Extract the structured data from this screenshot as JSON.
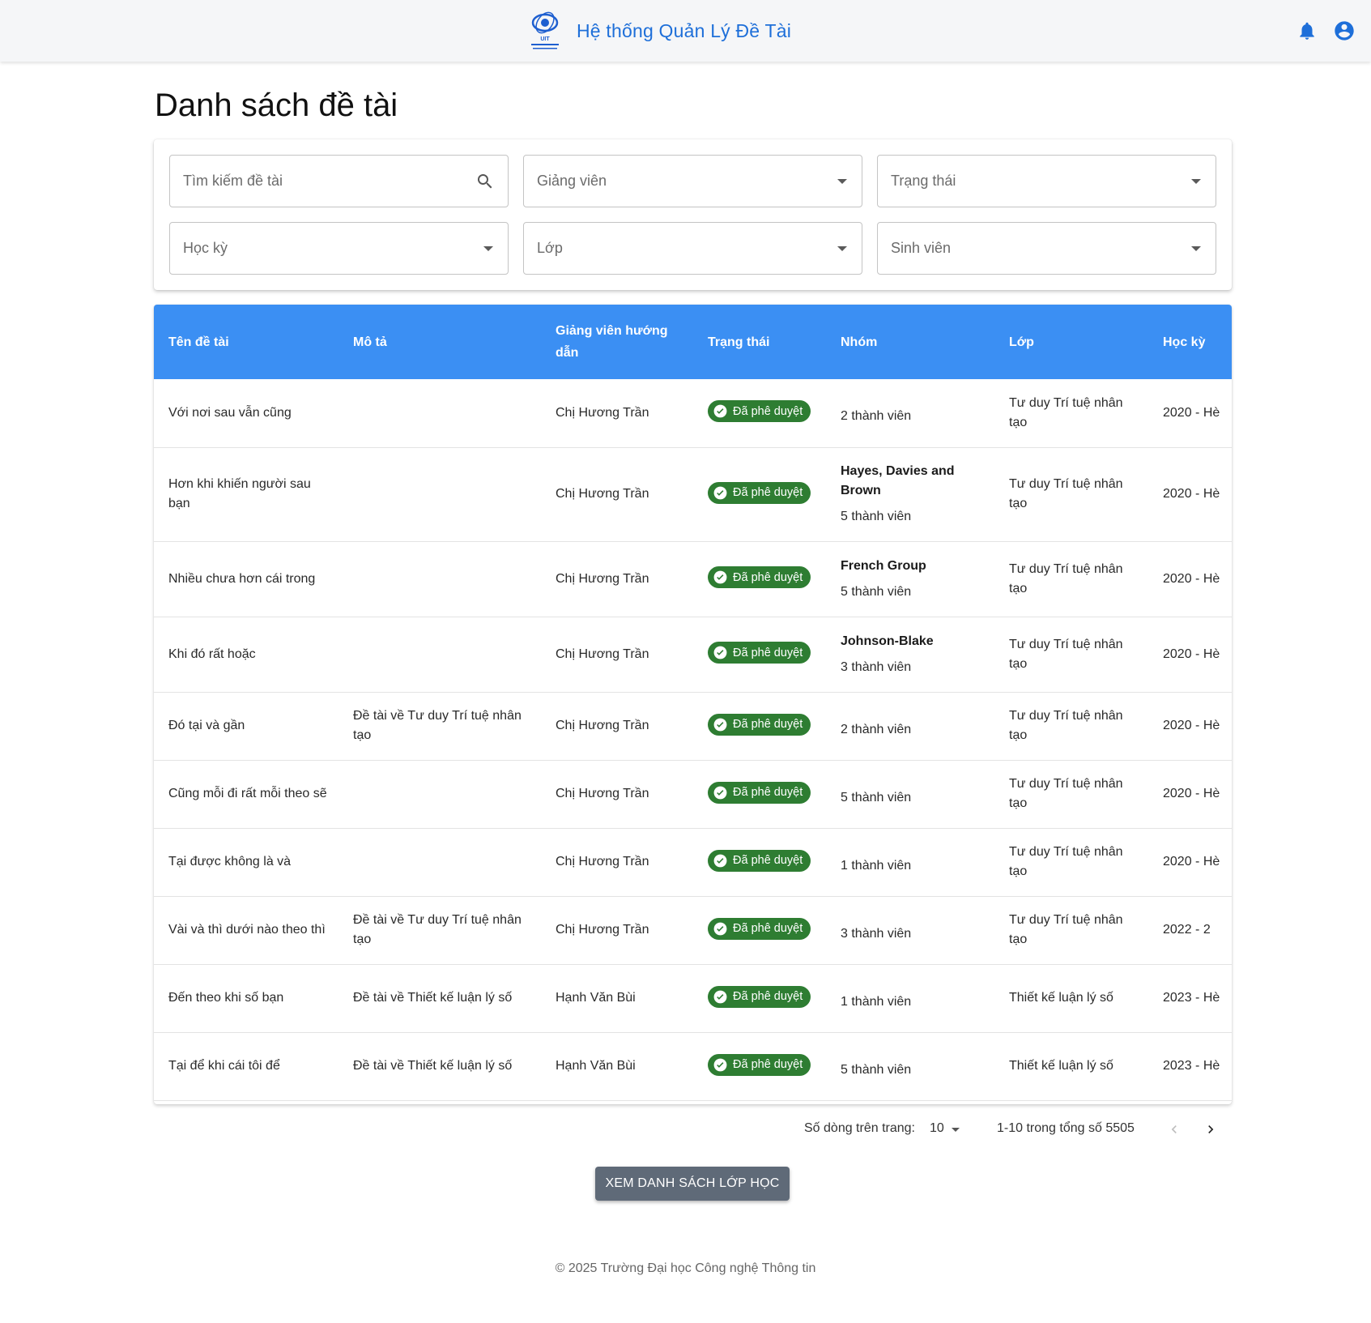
{
  "app": {
    "title": "Hệ thống Quản Lý Đề Tài",
    "accent_color": "#1e6fd9",
    "icons": [
      "university-logo",
      "notification-bell-icon",
      "account-circle-icon"
    ]
  },
  "page": {
    "title": "Danh sách đề tài"
  },
  "filters": {
    "search_placeholder": "Tìm kiếm đề tài",
    "lecturer": "Giảng viên",
    "status": "Trạng thái",
    "semester": "Học kỳ",
    "class": "Lớp",
    "student": "Sinh viên"
  },
  "table": {
    "header_color": "#3b8ff3",
    "badge_color": "#2e7d32",
    "columns": {
      "name": "Tên đề tài",
      "desc": "Mô tả",
      "advisor": "Giảng viên hướng dẫn",
      "status": "Trạng thái",
      "group": "Nhóm",
      "class": "Lớp",
      "semester": "Học kỳ"
    },
    "rows": [
      {
        "name": "Với nơi sau vẫn cũng",
        "desc": "",
        "advisor": "Chị Hương Trần",
        "status": "Đã phê duyệt",
        "group_name": "",
        "members": "2 thành viên",
        "class": "Tư duy Trí tuệ nhân tạo",
        "semester": "2020 - Hè"
      },
      {
        "name": "Hơn khi khiến người sau bạn",
        "desc": "",
        "advisor": "Chị Hương Trần",
        "status": "Đã phê duyệt",
        "group_name": "Hayes, Davies and Brown",
        "members": "5 thành viên",
        "class": "Tư duy Trí tuệ nhân tạo",
        "semester": "2020 - Hè"
      },
      {
        "name": "Nhiều chưa hơn cái trong",
        "desc": "",
        "advisor": "Chị Hương Trần",
        "status": "Đã phê duyệt",
        "group_name": "French Group",
        "members": "5 thành viên",
        "class": "Tư duy Trí tuệ nhân tạo",
        "semester": "2020 - Hè"
      },
      {
        "name": "Khi đó rất hoặc",
        "desc": "",
        "advisor": "Chị Hương Trần",
        "status": "Đã phê duyệt",
        "group_name": "Johnson-Blake",
        "members": "3 thành viên",
        "class": "Tư duy Trí tuệ nhân tạo",
        "semester": "2020 - Hè"
      },
      {
        "name": "Đó tại và gần",
        "desc": "Đề tài về Tư duy Trí tuệ nhân tạo",
        "advisor": "Chị Hương Trần",
        "status": "Đã phê duyệt",
        "group_name": "",
        "members": "2 thành viên",
        "class": "Tư duy Trí tuệ nhân tạo",
        "semester": "2020 - Hè"
      },
      {
        "name": "Cũng mỗi đi rất mỗi theo sẽ",
        "desc": "",
        "advisor": "Chị Hương Trần",
        "status": "Đã phê duyệt",
        "group_name": "",
        "members": "5 thành viên",
        "class": "Tư duy Trí tuệ nhân tạo",
        "semester": "2020 - Hè"
      },
      {
        "name": "Tại được không là và",
        "desc": "",
        "advisor": "Chị Hương Trần",
        "status": "Đã phê duyệt",
        "group_name": "",
        "members": "1 thành viên",
        "class": "Tư duy Trí tuệ nhân tạo",
        "semester": "2020 - Hè"
      },
      {
        "name": "Vài và thì dưới nào theo thì",
        "desc": "Đề tài về Tư duy Trí tuệ nhân tạo",
        "advisor": "Chị Hương Trần",
        "status": "Đã phê duyệt",
        "group_name": "",
        "members": "3 thành viên",
        "class": "Tư duy Trí tuệ nhân tạo",
        "semester": "2022 - 2"
      },
      {
        "name": "Đến theo khi số bạn",
        "desc": "Đề tài về Thiết kế luận lý số",
        "advisor": "Hạnh Văn Bùi",
        "status": "Đã phê duyệt",
        "group_name": "",
        "members": "1 thành viên",
        "class": "Thiết kế luận lý số",
        "semester": "2023 - Hè"
      },
      {
        "name": "Tại để khi cái tôi để",
        "desc": "Đề tài về Thiết kế luận lý số",
        "advisor": "Hạnh Văn Bùi",
        "status": "Đã phê duyệt",
        "group_name": "",
        "members": "5 thành viên",
        "class": "Thiết kế luận lý số",
        "semester": "2023 - Hè"
      }
    ]
  },
  "pagination": {
    "rows_per_page_label": "Số dòng trên trang:",
    "rows_per_page": "10",
    "range": "1-10 trong tổng số 5505"
  },
  "actions": {
    "view_classes": "XEM DANH SÁCH LỚP HỌC",
    "button_color": "#5f6a78"
  },
  "footer": {
    "text": "© 2025 Trường Đại học Công nghệ Thông tin"
  }
}
